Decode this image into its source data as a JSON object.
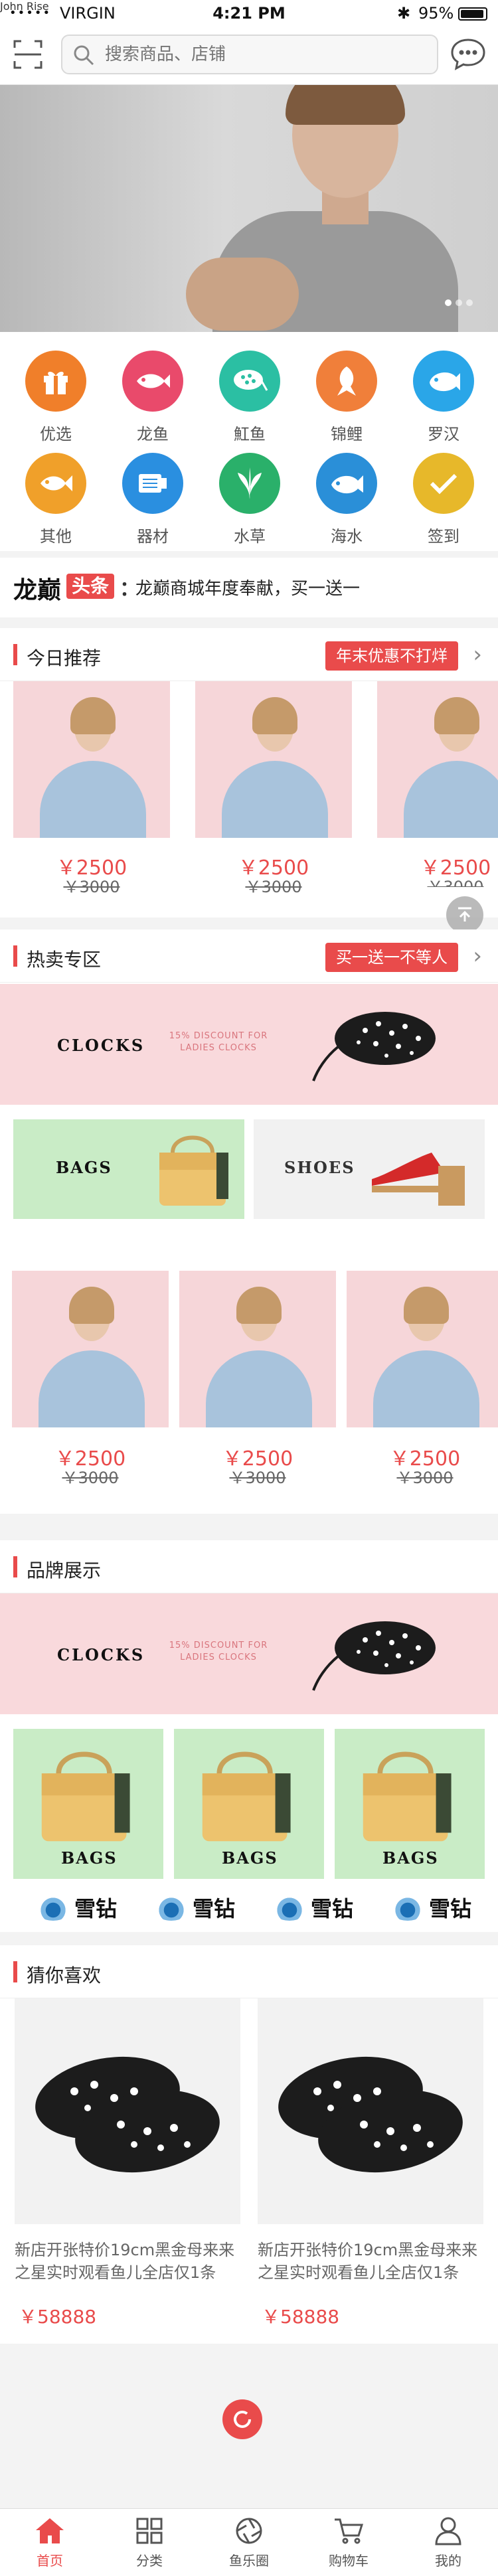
{
  "status_bar": {
    "signal": "•••••",
    "carrier": "VIRGIN",
    "time": "4:21 PM",
    "battery": "95%"
  },
  "search": {
    "placeholder": "搜索商品、店铺"
  },
  "banner": {
    "title": "John Rise",
    "slide_count": 3,
    "active_slide": 1
  },
  "categories": [
    {
      "label": "优选",
      "color": "#f07f2a",
      "icon": "gift-icon"
    },
    {
      "label": "龙鱼",
      "color": "#e94a6b",
      "icon": "arowana-icon"
    },
    {
      "label": "魟鱼",
      "color": "#2bbfa3",
      "icon": "stingray-icon"
    },
    {
      "label": "锦鲤",
      "color": "#f07f3a",
      "icon": "koi-icon"
    },
    {
      "label": "罗汉",
      "color": "#2aa6e8",
      "icon": "flowerhorn-icon"
    },
    {
      "label": "其他",
      "color": "#f0a02a",
      "icon": "fish-icon"
    },
    {
      "label": "器材",
      "color": "#2a8fe0",
      "icon": "equipment-icon"
    },
    {
      "label": "水草",
      "color": "#2ab06a",
      "icon": "plant-icon"
    },
    {
      "label": "海水",
      "color": "#2a8fd8",
      "icon": "marine-fish-icon"
    },
    {
      "label": "签到",
      "color": "#e7b82a",
      "icon": "checkin-icon"
    }
  ],
  "headline": {
    "brand": "龙巅",
    "tag": "头条",
    "colon": "：",
    "text": "龙巅商城年度奉献，买一送一"
  },
  "today": {
    "title": "今日推荐",
    "promo": "年末优惠不打烊",
    "products": [
      {
        "price": "￥2500",
        "original": "￥3000"
      },
      {
        "price": "￥2500",
        "original": "￥3000"
      },
      {
        "price": "￥2500",
        "original": "￥3000"
      }
    ]
  },
  "hot": {
    "title": "热卖专区",
    "promo": "买一送一不等人",
    "clocks_label": "CLOCKS",
    "clocks_discount": "15% DISCOUNT FOR LADIES CLOCKS",
    "bags_label": "BAGS",
    "shoes_label": "SHOES",
    "products": [
      {
        "price": "￥2500",
        "original": "￥3000"
      },
      {
        "price": "￥2500",
        "original": "￥3000"
      },
      {
        "price": "￥2500",
        "original": "￥3000"
      }
    ]
  },
  "brands": {
    "title": "品牌展示",
    "clocks_label": "CLOCKS",
    "clocks_discount": "15% DISCOUNT FOR LADIES CLOCKS",
    "bags": [
      "BAGS",
      "BAGS",
      "BAGS"
    ],
    "logos": [
      "雪钻",
      "雪钻",
      "雪钻",
      "雪钻"
    ]
  },
  "guess": {
    "title": "猜你喜欢",
    "items": [
      {
        "desc": "新店开张特价19cm黑金母来来之星实时观看鱼儿全店仅1条",
        "price": "￥58888"
      },
      {
        "desc": "新店开张特价19cm黑金母来来之星实时观看鱼儿全店仅1条",
        "price": "￥58888"
      }
    ]
  },
  "tabs": [
    {
      "label": "首页",
      "icon": "home-icon",
      "active": true
    },
    {
      "label": "分类",
      "icon": "grid-icon",
      "active": false
    },
    {
      "label": "鱼乐圈",
      "icon": "aperture-icon",
      "active": false
    },
    {
      "label": "购物车",
      "icon": "cart-icon",
      "active": false
    },
    {
      "label": "我的",
      "icon": "user-icon",
      "active": false
    }
  ],
  "colors": {
    "accent": "#e94b4b",
    "pink_bg": "#f9d9dc",
    "green_bg": "#c9ecc6"
  }
}
